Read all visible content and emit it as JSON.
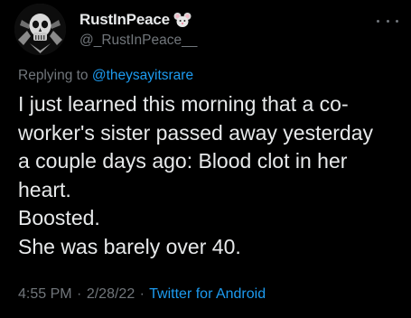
{
  "author": {
    "display_name": "RustInPeace",
    "emoji_icon": "mouse-face-icon",
    "handle": "@_RustInPeace__",
    "avatar_icon": "skull-avatar-icon"
  },
  "menu": {
    "more_icon": "more-options-icon"
  },
  "reply": {
    "prefix": "Replying to ",
    "to_handle": "@theysayitsrare"
  },
  "tweet": {
    "lines": [
      "I just learned this morning that a co-",
      "worker's sister passed away yesterday",
      "a couple days ago: Blood clot in her",
      "heart.",
      "Boosted.",
      "She was barely over 40."
    ]
  },
  "meta": {
    "time": "4:55 PM",
    "separator": "·",
    "date": "2/28/22",
    "source": "Twitter for Android"
  },
  "colors": {
    "background": "#000000",
    "text": "#e7e9ea",
    "muted": "#71767b",
    "link": "#1d9bf0"
  }
}
